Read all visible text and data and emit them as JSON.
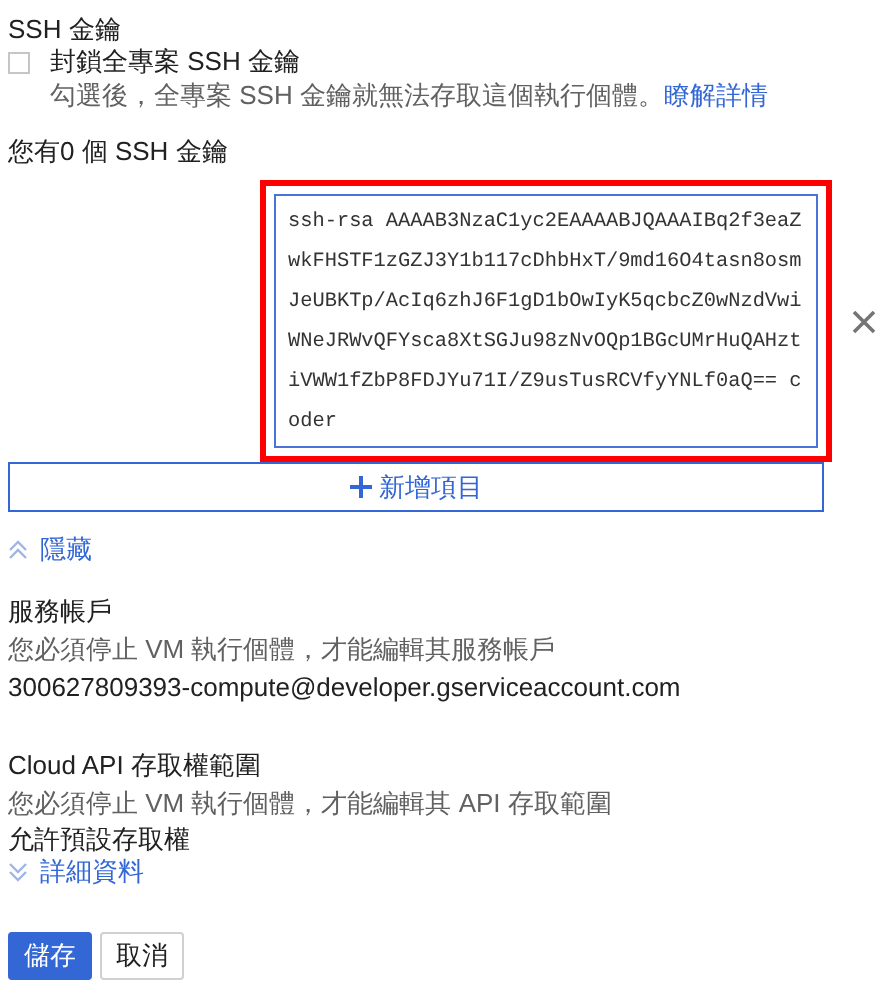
{
  "section_title": "SSH 金鑰",
  "block_option": {
    "label": "封鎖全專案 SSH 金鑰",
    "checked": false,
    "hint": "勾選後，全專案 SSH 金鑰就無法存取這個執行個體。",
    "link": "瞭解詳情"
  },
  "key_count": "您有0 個 SSH 金鑰",
  "ssh_key_field": {
    "value": "ssh-rsa AAAAB3NzaC1yc2EAAAABJQAAAIBq2f3eaZwkFHSTF1zGZJ3Y1b117cDhbHxT/9md16O4tasn8osmJeUBKTp/AcIq6zhJ6F1gD1bOwIyK5qcbcZ0wNzdVwiWNeJRWvQFYsca8XtSGJu98zNvOQp1BGcUMrHuQAHztiVWW1fZbP8FDJYu71I/Z9usTusRCVfyYNLf0aQ== coder",
    "highlighted": true
  },
  "add_item_button": "新增項目",
  "hide_toggle": {
    "label": "隱藏",
    "expanded": true
  },
  "service_account": {
    "title": "服務帳戶",
    "note": "您必須停止 VM 執行個體，才能編輯其服務帳戶",
    "value": "300627809393-compute@developer.gserviceaccount.com"
  },
  "api_scopes": {
    "title": "Cloud API 存取權範圍",
    "note": "您必須停止 VM 執行個體，才能編輯其 API 存取範圍",
    "value": "允許預設存取權"
  },
  "details_toggle": {
    "label": "詳細資料",
    "expanded": false
  },
  "buttons": [
    {
      "label": "儲存",
      "kind": "primary"
    },
    {
      "label": "取消",
      "kind": "secondary"
    }
  ]
}
